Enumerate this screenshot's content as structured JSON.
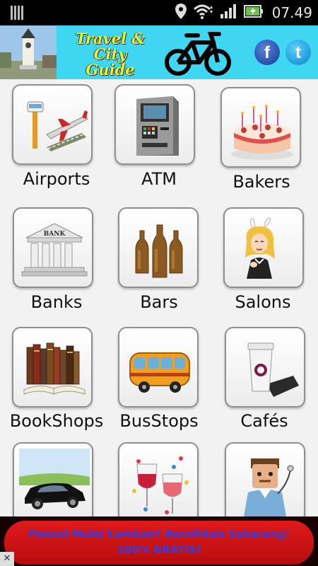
{
  "status_bar": {
    "time": "07.49",
    "icons": [
      "notification-icon",
      "location-icon",
      "wifi-icon",
      "signal-icon",
      "battery-charging-icon"
    ]
  },
  "header": {
    "title_line1": "Travel & City",
    "title_line2": "Guide",
    "icons": [
      "city-photo",
      "bicycle-icon"
    ],
    "facebook_label": "f",
    "twitter_label": "t"
  },
  "categories": [
    {
      "label": "Airports",
      "icon": "airport-icon"
    },
    {
      "label": "ATM",
      "icon": "atm-icon"
    },
    {
      "label": "Bakers",
      "icon": "cake-icon"
    },
    {
      "label": "Banks",
      "icon": "bank-icon"
    },
    {
      "label": "Bars",
      "icon": "beer-bottles-icon"
    },
    {
      "label": "Salons",
      "icon": "salon-woman-icon"
    },
    {
      "label": "BookShops",
      "icon": "books-icon"
    },
    {
      "label": "BusStops",
      "icon": "bus-icon"
    },
    {
      "label": "Cafés",
      "icon": "coffee-cup-icon"
    },
    {
      "label": "",
      "icon": "car-icon"
    },
    {
      "label": "",
      "icon": "wine-glasses-icon"
    },
    {
      "label": "",
      "icon": "doctor-icon"
    }
  ],
  "ad": {
    "line1": "Ponsel Mulai Lamban? Bersihkan Sekarang!",
    "line2": "100% GRATIS!",
    "close_label": "✕"
  },
  "colors": {
    "header_bg": "#3fd6f2",
    "title_yellow": "#e9f22a",
    "ad_red": "#d01414",
    "ad_text_blue": "#2d3df2"
  }
}
